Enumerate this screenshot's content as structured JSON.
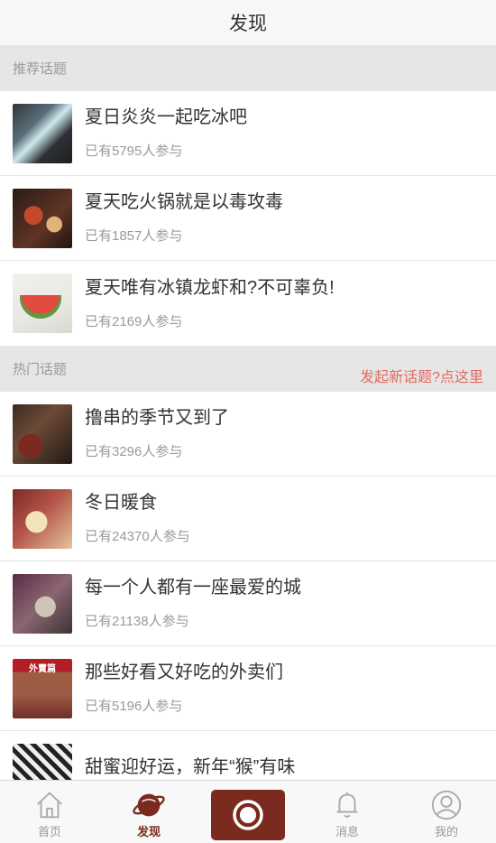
{
  "header": {
    "title": "发现"
  },
  "recommended": {
    "label": "推荐话题",
    "items": [
      {
        "title": "夏日炎炎一起吃冰吧",
        "count": "已有5795人参与"
      },
      {
        "title": "夏天吃火锅就是以毒攻毒",
        "count": "已有1857人参与"
      },
      {
        "title": "夏天唯有冰镇龙虾和?不可辜负!",
        "count": "已有2169人参与"
      }
    ]
  },
  "hot": {
    "label": "热门话题",
    "new_topic_link": "发起新话题?点这里",
    "items": [
      {
        "title": "撸串的季节又到了",
        "count": "已有3296人参与"
      },
      {
        "title": "冬日暖食",
        "count": "已有24370人参与"
      },
      {
        "title": "每一个人都有一座最爱的城",
        "count": "已有21138人参与"
      },
      {
        "title": "那些好看又好吃的外卖们",
        "count": "已有5196人参与",
        "thumb_text": "外賣篇"
      },
      {
        "title": "甜蜜迎好运，新年“猴”有味",
        "count": ""
      }
    ]
  },
  "tabbar": {
    "home": "首页",
    "discover": "发现",
    "messages": "消息",
    "mine": "我的"
  },
  "colors": {
    "accent": "#7a2a1f",
    "link": "#e26a63"
  }
}
